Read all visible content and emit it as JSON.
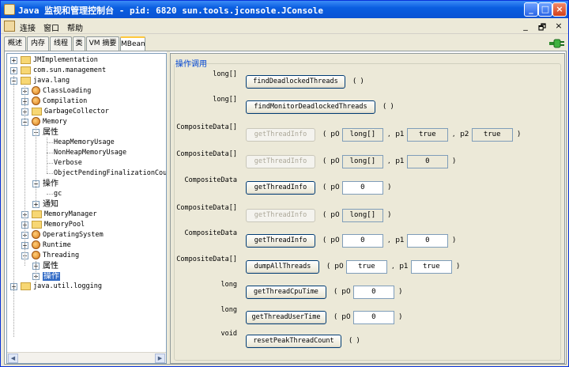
{
  "window": {
    "title": "Java 监视和管理控制台 - pid: 6820 sun.tools.jconsole.JConsole"
  },
  "menu": {
    "items": [
      "连接",
      "窗口",
      "帮助"
    ],
    "mdi_controls": [
      "_",
      "🗗",
      "×"
    ]
  },
  "tabs": [
    {
      "label": "概述",
      "selected": false
    },
    {
      "label": "内存",
      "selected": false
    },
    {
      "label": "线程",
      "selected": false
    },
    {
      "label": "类",
      "selected": false
    },
    {
      "label": "VM 摘要",
      "selected": false
    },
    {
      "label": "MBean",
      "selected": true
    }
  ],
  "tree": {
    "nodes": [
      {
        "label": "JMImplementation",
        "icon": "folder-icon",
        "expander": "+"
      },
      {
        "label": "com.sun.management",
        "icon": "folder-icon",
        "expander": "+"
      },
      {
        "label": "java.lang",
        "icon": "folder-icon",
        "expander": "-"
      },
      {
        "label": "ClassLoading",
        "icon": "bean-icon",
        "expander": "+"
      },
      {
        "label": "Compilation",
        "icon": "bean-icon",
        "expander": "+"
      },
      {
        "label": "GarbageCollector",
        "icon": "folder-icon",
        "expander": "+"
      },
      {
        "label": "Memory",
        "icon": "bean-icon",
        "expander": "-"
      },
      {
        "label": "属性",
        "icon": "",
        "expander": "-"
      },
      {
        "label": "HeapMemoryUsage",
        "icon": "",
        "expander": ""
      },
      {
        "label": "NonHeapMemoryUsage",
        "icon": "",
        "expander": ""
      },
      {
        "label": "Verbose",
        "icon": "",
        "expander": ""
      },
      {
        "label": "ObjectPendingFinalizationCoun",
        "icon": "",
        "expander": ""
      },
      {
        "label": "操作",
        "icon": "",
        "expander": "-"
      },
      {
        "label": "gc",
        "icon": "",
        "expander": ""
      },
      {
        "label": "通知",
        "icon": "",
        "expander": "+"
      },
      {
        "label": "MemoryManager",
        "icon": "folder-icon",
        "expander": "+"
      },
      {
        "label": "MemoryPool",
        "icon": "folder-icon",
        "expander": "+"
      },
      {
        "label": "OperatingSystem",
        "icon": "bean-icon",
        "expander": "+"
      },
      {
        "label": "Runtime",
        "icon": "bean-icon",
        "expander": "+"
      },
      {
        "label": "Threading",
        "icon": "bean-icon",
        "expander": "-"
      },
      {
        "label": "属性",
        "icon": "",
        "expander": "+"
      },
      {
        "label": "操作",
        "icon": "",
        "expander": "+",
        "selected": true
      },
      {
        "label": "java.util.logging",
        "icon": "folder-icon",
        "expander": "+"
      }
    ]
  },
  "ops": {
    "group_title": "操作调用",
    "rows": [
      {
        "ret": "long[]",
        "name": "findDeadlockedThreads",
        "enabled": true,
        "params": []
      },
      {
        "ret": "long[]",
        "name": "findMonitorDeadlockedThreads",
        "enabled": true,
        "params": []
      },
      {
        "ret": "CompositeData[]",
        "name": "getThreadInfo",
        "enabled": false,
        "params": [
          {
            "name": "p0",
            "value": "long[]",
            "enabled": false
          },
          {
            "name": "p1",
            "value": "true",
            "enabled": false
          },
          {
            "name": "p2",
            "value": "true",
            "enabled": false
          }
        ]
      },
      {
        "ret": "CompositeData[]",
        "name": "getThreadInfo",
        "enabled": false,
        "params": [
          {
            "name": "p0",
            "value": "long[]",
            "enabled": false
          },
          {
            "name": "p1",
            "value": "0",
            "enabled": false
          }
        ]
      },
      {
        "ret": "CompositeData",
        "name": "getThreadInfo",
        "enabled": true,
        "params": [
          {
            "name": "p0",
            "value": "0",
            "enabled": true
          }
        ]
      },
      {
        "ret": "CompositeData[]",
        "name": "getThreadInfo",
        "enabled": false,
        "params": [
          {
            "name": "p0",
            "value": "long[]",
            "enabled": false
          }
        ]
      },
      {
        "ret": "CompositeData",
        "name": "getThreadInfo",
        "enabled": true,
        "params": [
          {
            "name": "p0",
            "value": "0",
            "enabled": true
          },
          {
            "name": "p1",
            "value": "0",
            "enabled": true
          }
        ]
      },
      {
        "ret": "CompositeData[]",
        "name": "dumpAllThreads",
        "enabled": true,
        "params": [
          {
            "name": "p0",
            "value": "true",
            "enabled": true
          },
          {
            "name": "p1",
            "value": "true",
            "enabled": true
          }
        ]
      },
      {
        "ret": "long",
        "name": "getThreadCpuTime",
        "enabled": true,
        "params": [
          {
            "name": "p0",
            "value": "0",
            "enabled": true
          }
        ]
      },
      {
        "ret": "long",
        "name": "getThreadUserTime",
        "enabled": true,
        "params": [
          {
            "name": "p0",
            "value": "0",
            "enabled": true
          }
        ]
      },
      {
        "ret": "void",
        "name": "resetPeakThreadCount",
        "enabled": true,
        "params": []
      }
    ]
  }
}
